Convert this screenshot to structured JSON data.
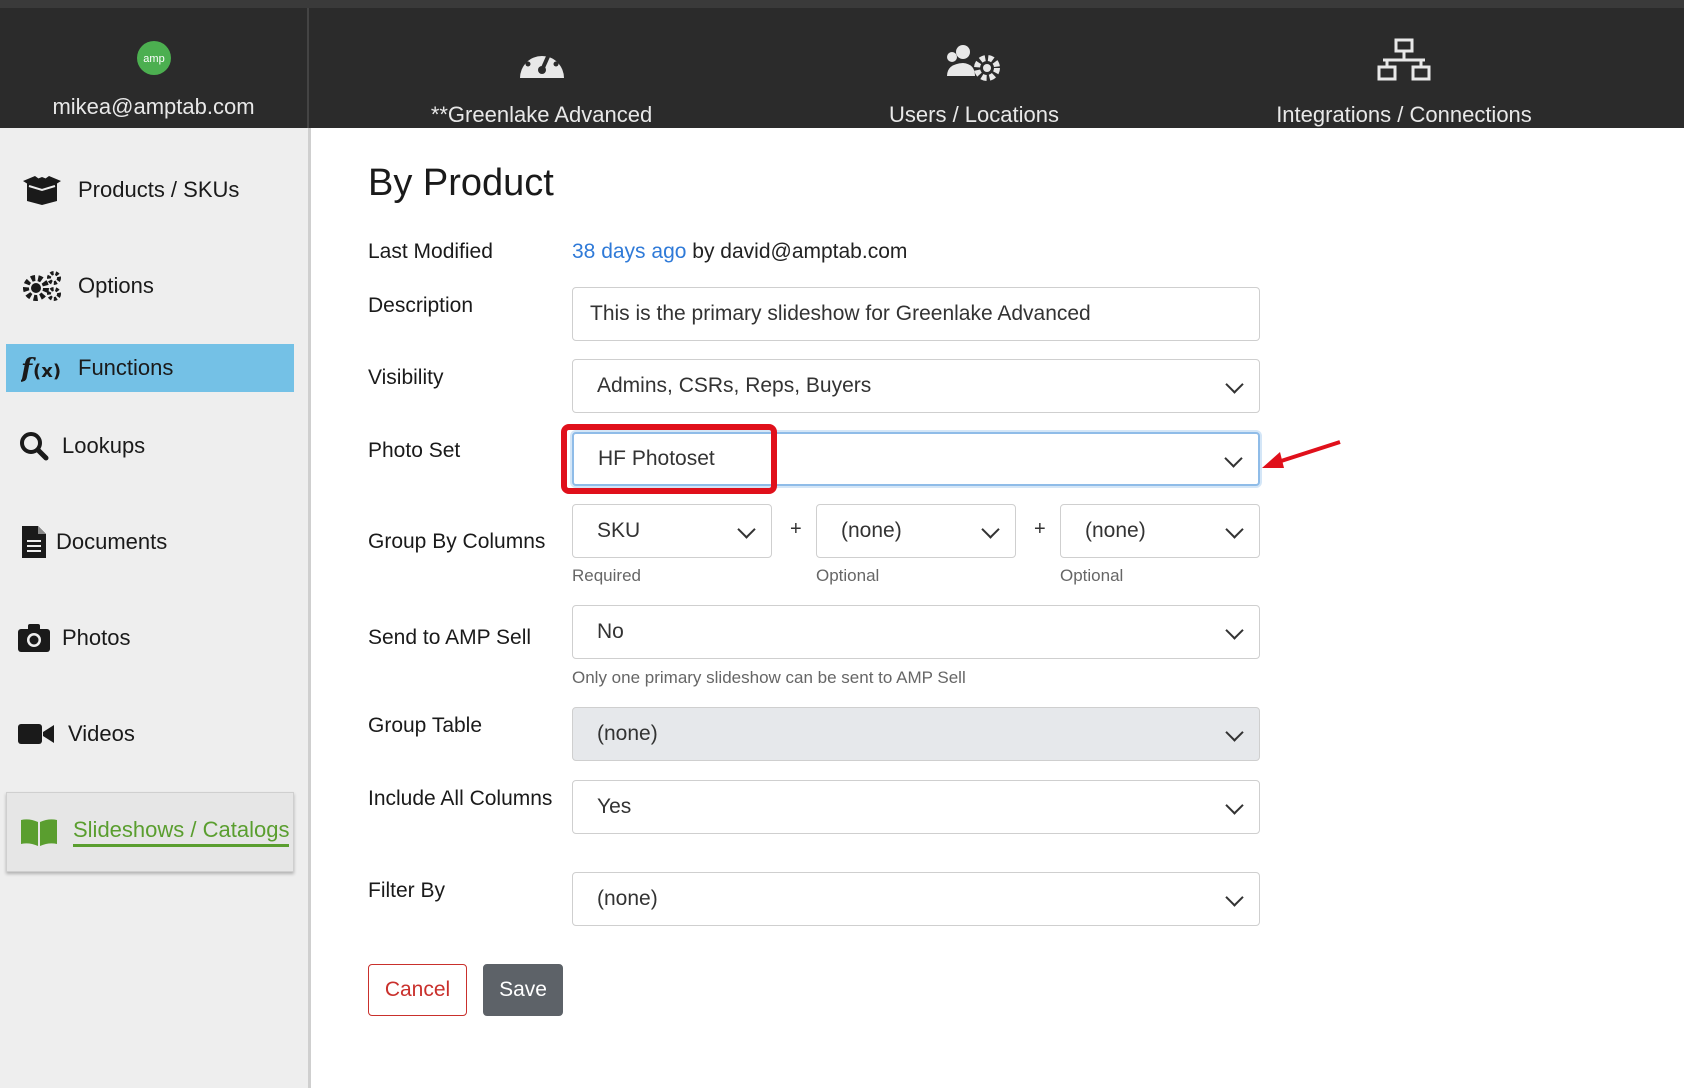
{
  "topbar": {
    "user_email": "mikea@amptab.com",
    "brand_icon": "amp-logo-icon",
    "items": [
      {
        "label": "**Greenlake Advanced",
        "icon": "dashboard-gauge-icon"
      },
      {
        "label": "Users / Locations",
        "icon": "users-gear-icon"
      },
      {
        "label": "Integrations / Connections",
        "icon": "network-icon"
      }
    ]
  },
  "sidebar": {
    "items": [
      {
        "label": "Products / SKUs",
        "icon": "open-box-icon"
      },
      {
        "label": "Options",
        "icon": "gears-icon"
      },
      {
        "label": "Functions",
        "icon": "function-icon",
        "active": true
      },
      {
        "label": "Lookups",
        "icon": "search-icon"
      },
      {
        "label": "Documents",
        "icon": "document-icon"
      },
      {
        "label": "Photos",
        "icon": "camera-icon"
      },
      {
        "label": "Videos",
        "icon": "video-icon"
      },
      {
        "label": "Slideshows / Catalogs",
        "icon": "book-icon",
        "active": true
      }
    ]
  },
  "form": {
    "title": "By Product",
    "last_modified_label": "Last Modified",
    "last_modified_link": "38 days ago",
    "last_modified_by": "by david@amptab.com",
    "description_label": "Description",
    "description_value": "This is the primary slideshow for Greenlake Advanced",
    "visibility_label": "Visibility",
    "visibility_value": "Admins, CSRs, Reps, Buyers",
    "photo_set_label": "Photo Set",
    "photo_set_value": "HF Photoset",
    "group_by_label": "Group By Columns",
    "group_by": [
      {
        "value": "SKU",
        "hint": "Required"
      },
      {
        "value": "(none)",
        "hint": "Optional"
      },
      {
        "value": "(none)",
        "hint": "Optional"
      }
    ],
    "plus": "+",
    "send_amp_label": "Send to AMP Sell",
    "send_amp_value": "No",
    "send_amp_hint": "Only one primary slideshow can be sent to AMP Sell",
    "group_table_label": "Group Table",
    "group_table_value": "(none)",
    "include_all_label": "Include All Columns",
    "include_all_value": "Yes",
    "filter_by_label": "Filter By",
    "filter_by_value": "(none)",
    "cancel_label": "Cancel",
    "save_label": "Save"
  },
  "colors": {
    "topbar_bg": "#2b2b2b",
    "sidebar_bg": "#eeeeee",
    "functions_active": "#74c1e6",
    "slideshows_active": "#5a9e2f",
    "link": "#2f7ad8",
    "annotation_red": "#e0101b"
  }
}
